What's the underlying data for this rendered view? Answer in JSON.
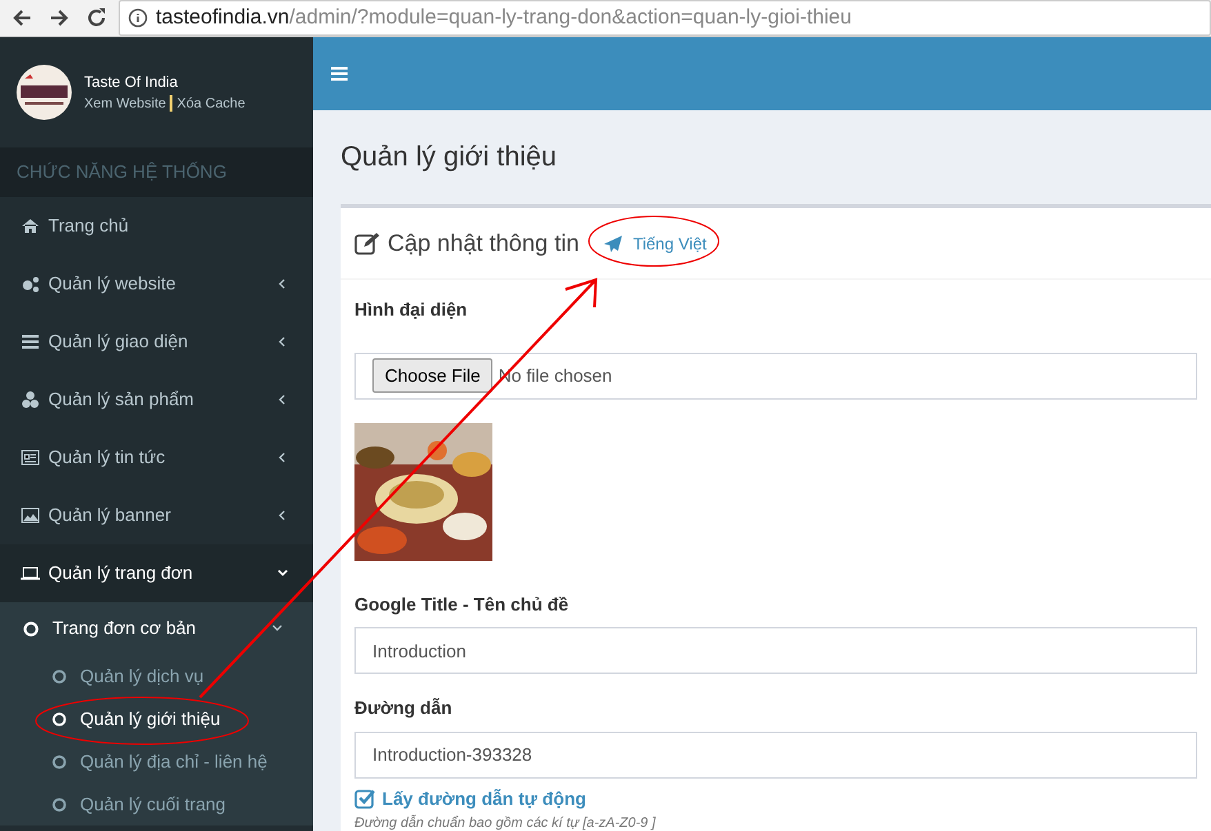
{
  "browser": {
    "url_host": "tasteofindia.vn",
    "url_path": "/admin/?module=quan-ly-trang-don&action=quan-ly-gioi-thieu"
  },
  "sidebar": {
    "brand": "Taste Of India",
    "links": [
      "Xem Website",
      "Xóa Cache"
    ],
    "section": "CHỨC NĂNG HỆ THỐNG",
    "items": [
      {
        "label": "Trang chủ",
        "kind": "link",
        "selected": false
      },
      {
        "label": "Quản lý website",
        "kind": "group",
        "selected": false,
        "expanded": false
      },
      {
        "label": "Quản lý giao diện",
        "kind": "group",
        "selected": false,
        "expanded": false
      },
      {
        "label": "Quản lý sản phẩm",
        "kind": "group",
        "selected": false,
        "expanded": false
      },
      {
        "label": "Quản lý tin tức",
        "kind": "group",
        "selected": false,
        "expanded": false
      },
      {
        "label": "Quản lý banner",
        "kind": "group",
        "selected": false,
        "expanded": false
      },
      {
        "label": "Quản lý trang đơn",
        "kind": "group",
        "selected": true,
        "expanded": true,
        "children": [
          {
            "label": "Trang đơn cơ bản",
            "expanded": true,
            "children": [
              {
                "label": "Quản lý dịch vụ",
                "selected": false
              },
              {
                "label": "Quản lý giới thiệu",
                "selected": true
              },
              {
                "label": "Quản lý địa chỉ - liên hệ",
                "selected": false
              },
              {
                "label": "Quản lý cuối trang",
                "selected": false
              }
            ]
          }
        ]
      }
    ]
  },
  "page_title": "Quản lý giới thiệu",
  "box": {
    "title": "Cập nhật thông tin",
    "language": "Tiếng Việt",
    "image_label": "Hình đại diện",
    "file_button": "Choose File",
    "file_status": "No file chosen",
    "title_label": "Google Title - Tên chủ đề",
    "title_value": "Introduction",
    "slug_label": "Đường dẫn",
    "slug_value": "Introduction-393328",
    "auto_slug": {
      "label": "Lấy đường dẫn tự động",
      "checked": true
    },
    "hint": "Đường dẫn chuẩn bao gồm các kí tự [a-zA-Z0-9 ]"
  }
}
